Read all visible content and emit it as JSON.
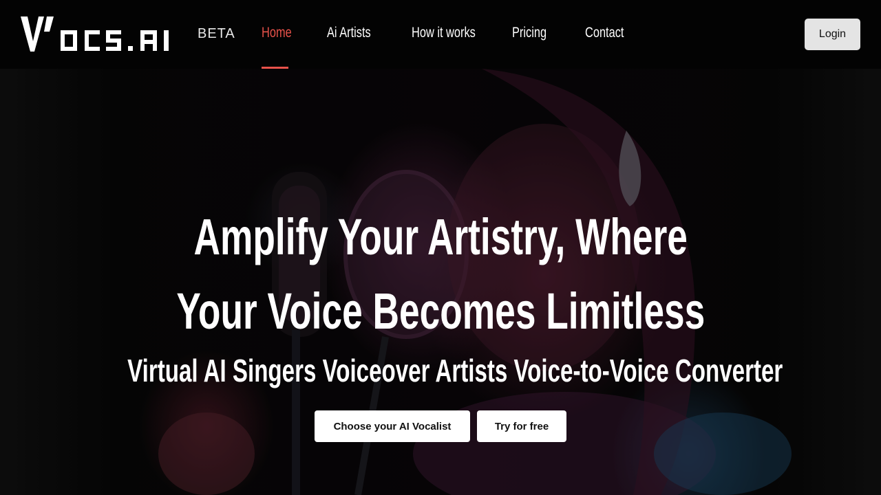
{
  "brand": {
    "logo_text": "VOCS.AI",
    "badge": "BETA"
  },
  "nav": {
    "items": [
      {
        "label": "Home",
        "active": true
      },
      {
        "label": "Ai Artists",
        "active": false
      },
      {
        "label": "How it works",
        "active": false
      },
      {
        "label": "Pricing",
        "active": false
      },
      {
        "label": "Contact",
        "active": false
      }
    ],
    "login_label": "Login"
  },
  "hero": {
    "headline_line1": "Amplify Your Artistry, Where",
    "headline_line2": "Your Voice Becomes Limitless",
    "subheadline": "Virtual AI Singers Voiceover Artists Voice-to-Voice Converter",
    "primary_cta": "Choose your AI Vocalist",
    "secondary_cta": "Try for free",
    "background_image": "singer-at-microphone-photo"
  },
  "colors": {
    "accent": "#e8524a",
    "header_bg": "#030303",
    "button_bg": "#ffffff",
    "login_bg": "#e4e4e4"
  }
}
